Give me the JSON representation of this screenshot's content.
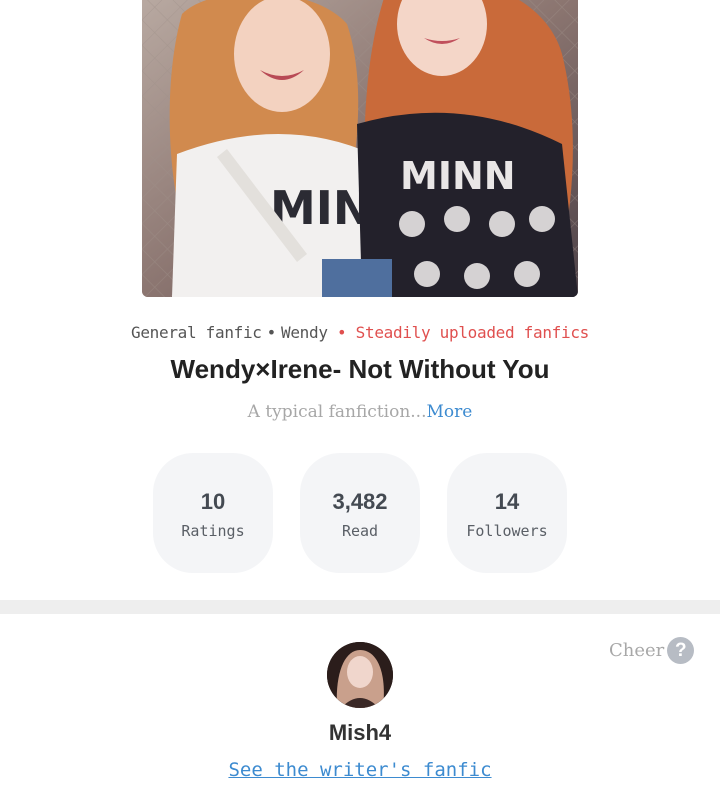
{
  "cover": {
    "image_alt": "Two women in graphic T-shirts posing together"
  },
  "meta": {
    "genre": "General fanfic",
    "separator": "•",
    "author_tag": "Wendy",
    "status": "• Steadily uploaded fanfics"
  },
  "title": "Wendy×Irene- Not Without You",
  "description": {
    "text": "A typical fanfiction...",
    "more_label": "More"
  },
  "stats": [
    {
      "value": "10",
      "label": "Ratings"
    },
    {
      "value": "3,482",
      "label": "Read"
    },
    {
      "value": "14",
      "label": "Followers"
    }
  ],
  "cheer": {
    "label": "Cheer",
    "help_glyph": "?"
  },
  "writer": {
    "name": "Mish4",
    "link_label": "See the writer's fanfic"
  },
  "colors": {
    "accent_blue": "#3d8bd0",
    "status_red": "#e0504f",
    "stat_bg": "#f4f5f7",
    "divider": "#eeeeee"
  }
}
